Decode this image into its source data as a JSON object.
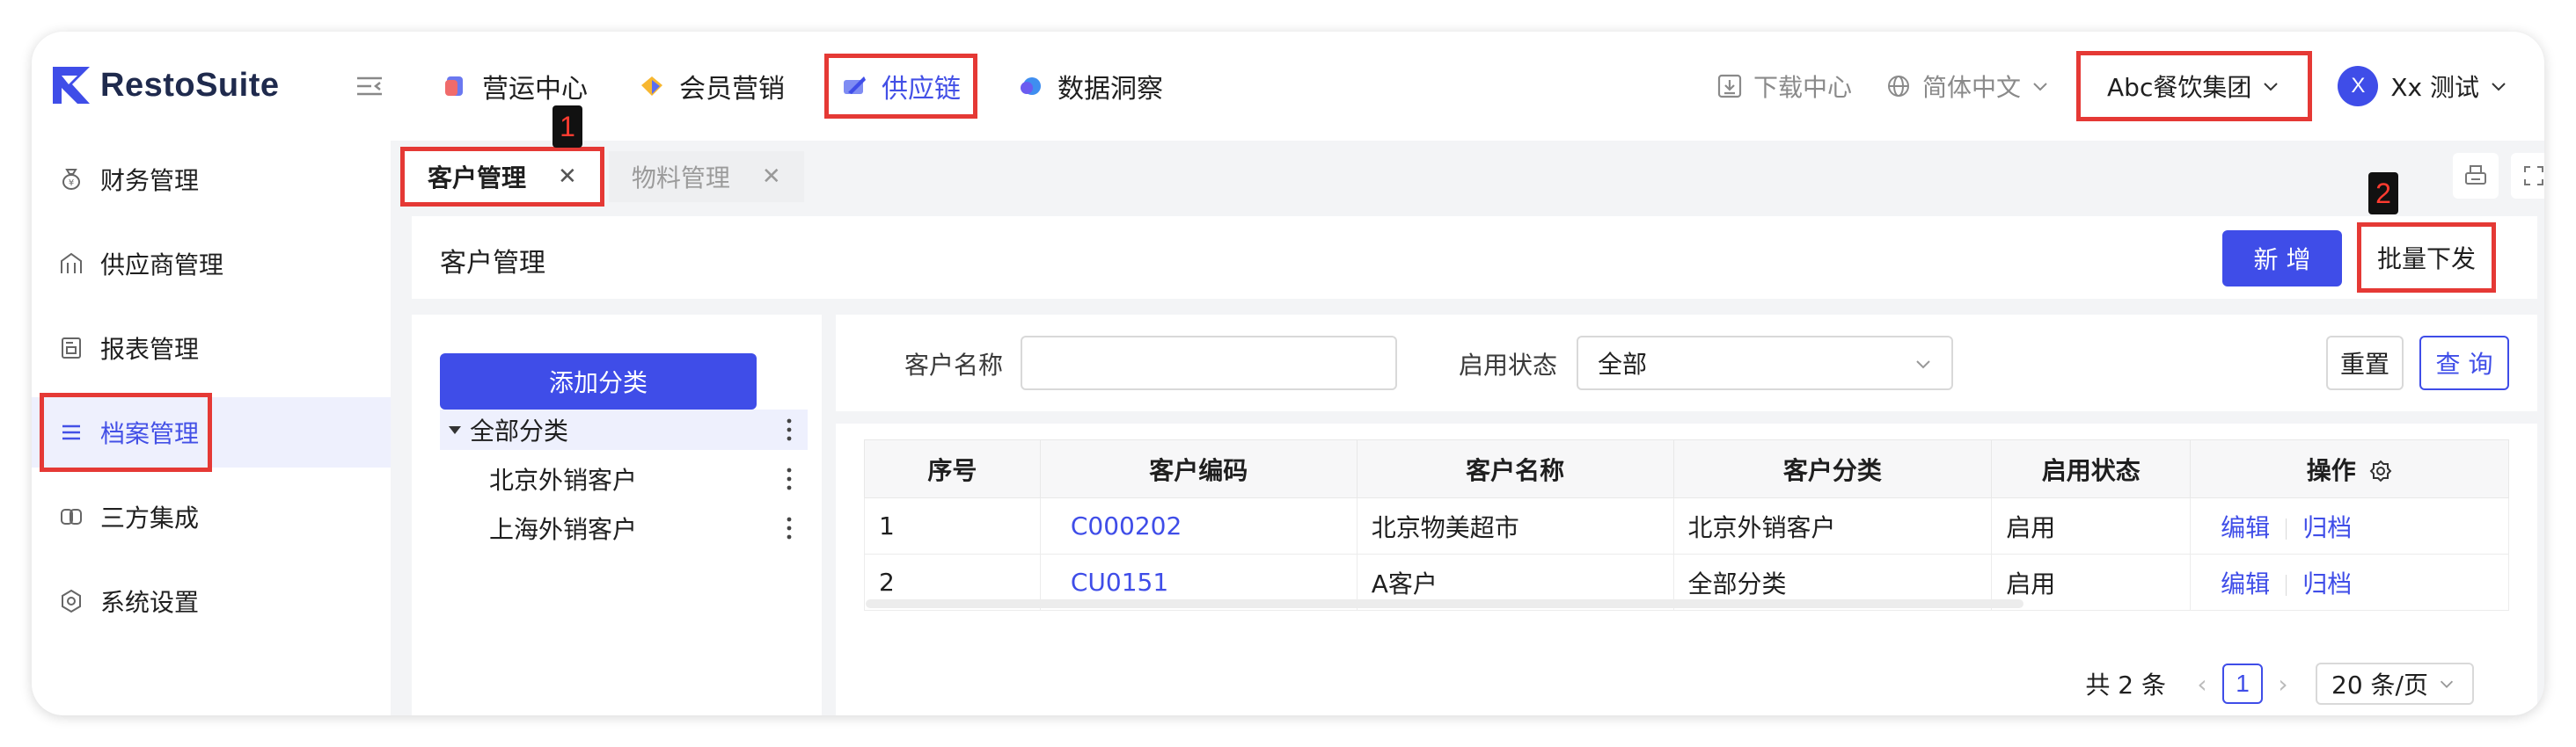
{
  "app": {
    "name": "RestoSuite"
  },
  "nav": {
    "items": [
      {
        "label": "营运中心",
        "icon": "cube-red-icon",
        "active": false
      },
      {
        "label": "会员营销",
        "icon": "diamond-icon",
        "active": false
      },
      {
        "label": "供应链",
        "icon": "supply-chain-icon",
        "active": true
      },
      {
        "label": "数据洞察",
        "icon": "data-insight-icon",
        "active": false
      }
    ]
  },
  "tools": {
    "download": "下载中心",
    "language": "简体中文",
    "org": "Abc餐饮集团",
    "user_initial": "X",
    "user_name": "Xx 测试"
  },
  "sidebar": {
    "items": [
      {
        "label": "财务管理",
        "icon": "finance-icon"
      },
      {
        "label": "供应商管理",
        "icon": "supplier-icon"
      },
      {
        "label": "报表管理",
        "icon": "report-icon"
      },
      {
        "label": "档案管理",
        "icon": "archive-list-icon",
        "active": true
      },
      {
        "label": "三方集成",
        "icon": "integration-icon"
      },
      {
        "label": "系统设置",
        "icon": "settings-icon"
      }
    ]
  },
  "tabs": [
    {
      "label": "客户管理",
      "active": true
    },
    {
      "label": "物料管理",
      "active": false
    }
  ],
  "badges": {
    "one": "1",
    "two": "2"
  },
  "page": {
    "title": "客户管理",
    "new_button": "新 增",
    "batch_button": "批量下发"
  },
  "category": {
    "add_button": "添加分类",
    "root": "全部分类",
    "children": [
      "北京外销客户",
      "上海外销客户"
    ]
  },
  "filters": {
    "name_label": "客户名称",
    "name_value": "",
    "status_label": "启用状态",
    "status_value": "全部",
    "reset": "重置",
    "query": "查 询"
  },
  "table": {
    "headers": [
      "序号",
      "客户编码",
      "客户名称",
      "客户分类",
      "启用状态",
      "操作"
    ],
    "rows": [
      {
        "index": "1",
        "code": "C000202",
        "name": "北京物美超市",
        "category": "北京外销客户",
        "status": "启用",
        "edit": "编辑",
        "archive": "归档"
      },
      {
        "index": "2",
        "code": "CU0151",
        "name": "A客户",
        "category": "全部分类",
        "status": "启用",
        "edit": "编辑",
        "archive": "归档"
      }
    ]
  },
  "pager": {
    "total": "共 2 条",
    "current": "1",
    "page_size": "20 条/页"
  },
  "colors": {
    "primary": "#3f4de8",
    "highlight_red": "#e53935",
    "badge_bg": "#111111"
  }
}
